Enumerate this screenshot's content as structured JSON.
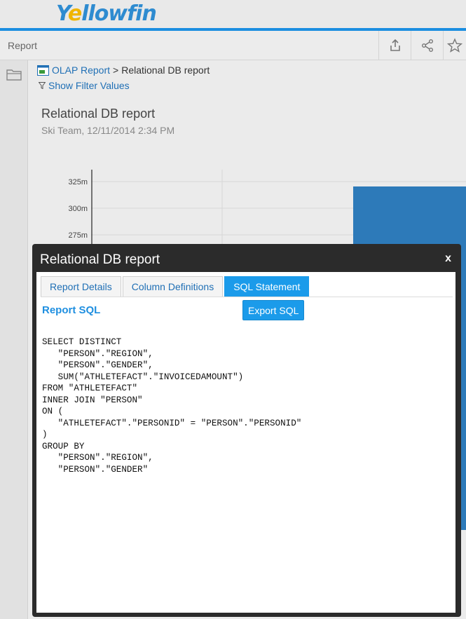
{
  "header": {
    "logo_part1": "Y",
    "logo_part2": "e",
    "logo_part3": "llowfin",
    "toolbar_title": "Report"
  },
  "toolbar": {
    "buttons": [
      {
        "icon": "export-icon"
      },
      {
        "icon": "share-icon"
      },
      {
        "icon": "star-icon"
      }
    ]
  },
  "breadcrumb": {
    "parent": "OLAP Report",
    "separator": ">",
    "current": "Relational DB report"
  },
  "filter_link": "Show Filter Values",
  "report": {
    "title": "Relational DB report",
    "subtitle": "Ski Team, 12/11/2014 2:34 PM"
  },
  "chart_data": {
    "type": "bar",
    "y_tick_labels": [
      "325m",
      "300m",
      "275m"
    ],
    "series_color": "#2d7ab9"
  },
  "modal": {
    "title": "Relational DB report",
    "close_label": "x",
    "tabs": [
      {
        "label": "Report Details",
        "active": false
      },
      {
        "label": "Column Definitions",
        "active": false
      },
      {
        "label": "SQL Statement",
        "active": true
      }
    ],
    "sql_heading": "Report SQL",
    "export_label": "Export SQL",
    "sql_text": "SELECT DISTINCT\n   \"PERSON\".\"REGION\",\n   \"PERSON\".\"GENDER\",\n   SUM(\"ATHLETEFACT\".\"INVOICEDAMOUNT\")\nFROM \"ATHLETEFACT\"\nINNER JOIN \"PERSON\"\nON (\n   \"ATHLETEFACT\".\"PERSONID\" = \"PERSON\".\"PERSONID\"\n)\nGROUP BY\n   \"PERSON\".\"REGION\",\n   \"PERSON\".\"GENDER\""
  },
  "colors": {
    "accent": "#1b8ee0",
    "link": "#1f6fb5",
    "active_tab": "#1b9bea",
    "modal_frame": "#2b2b2b"
  }
}
